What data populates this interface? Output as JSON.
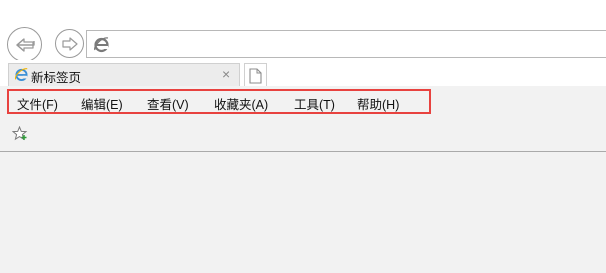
{
  "browser": {
    "back_icon": "back-arrow-icon",
    "forward_icon": "forward-arrow-icon",
    "address_icon": "ie-logo-icon",
    "address_value": ""
  },
  "tab": {
    "icon": "ie-logo-icon",
    "title": "新标签页",
    "close_glyph": "×",
    "new_tab_icon": "new-tab-icon"
  },
  "menu": {
    "items": [
      {
        "label": "文件(F)"
      },
      {
        "label": "编辑(E)"
      },
      {
        "label": "查看(V)"
      },
      {
        "label": "收藏夹(A)"
      },
      {
        "label": "工具(T)"
      },
      {
        "label": "帮助(H)"
      }
    ],
    "highlight_color": "#e8423f"
  },
  "favorites_bar": {
    "icon": "add-favorite-star-icon"
  },
  "colors": {
    "content_bg": "#f2f2f2",
    "tab_bg": "#ececec",
    "ie_blue": "#3a8fd6"
  }
}
